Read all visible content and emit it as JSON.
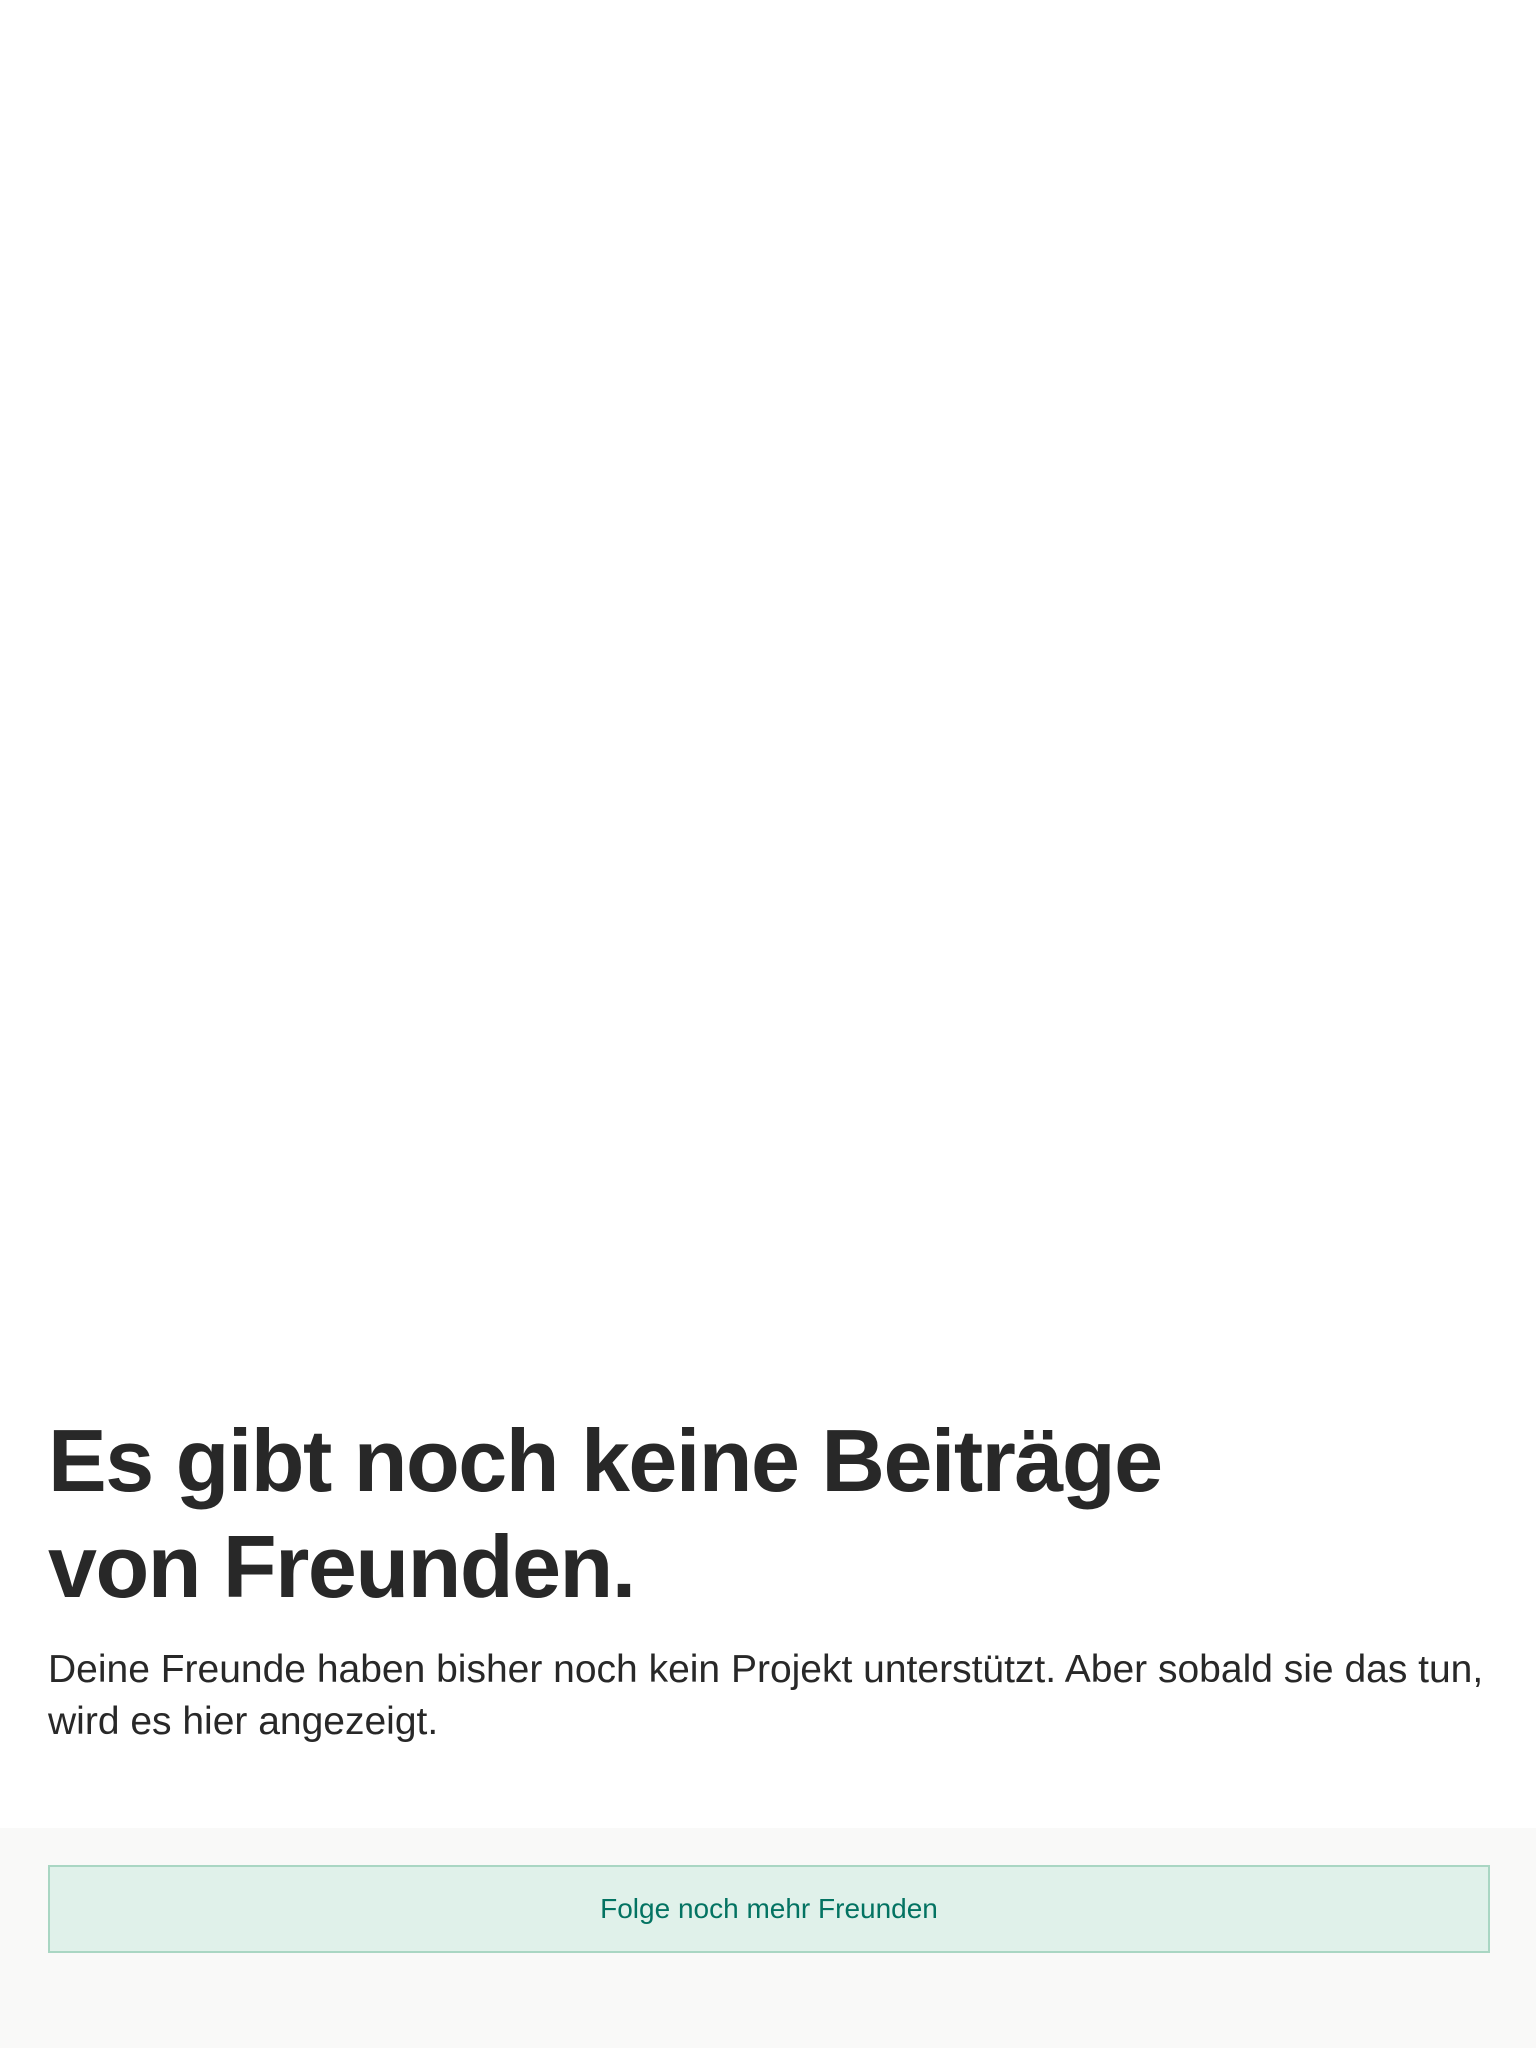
{
  "empty_state": {
    "headline_line1": "Es gibt noch keine Beiträge",
    "headline_line2": "von Freunden.",
    "description": "Deine Freunde haben bisher noch kein Projekt unterstützt. Aber sobald sie das tun, wird es hier angezeigt."
  },
  "footer": {
    "follow_button_label": "Folge noch mehr Freunden"
  },
  "colors": {
    "text": "#282828",
    "button_background": "#e0f1ea",
    "button_border": "#a9d6c3",
    "button_text": "#037362",
    "footer_background": "#f9f9f8"
  }
}
